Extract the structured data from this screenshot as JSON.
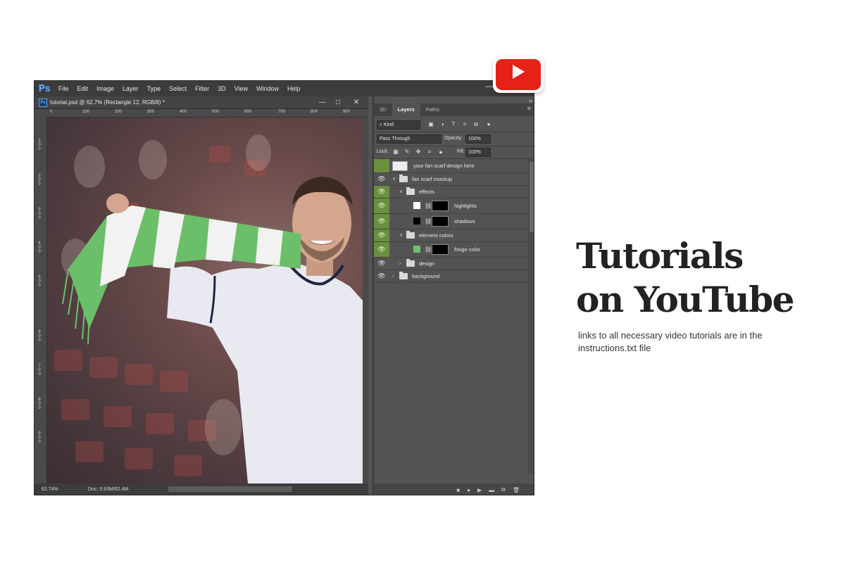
{
  "app": {
    "logo": "Ps",
    "menu": [
      "File",
      "Edit",
      "Image",
      "Layer",
      "Type",
      "Select",
      "Filter",
      "3D",
      "View",
      "Window",
      "Help"
    ],
    "minimize_glyph": "—"
  },
  "document": {
    "tab_icon": "Ps",
    "tab_title": "tutorial.psd @ 62.7% (Rectangle 12, RGB/8) *",
    "ctl_min": "—",
    "ctl_max": "□",
    "ctl_close": "✕",
    "ruler_top": [
      "0",
      "100",
      "200",
      "300",
      "400",
      "500",
      "600",
      "700",
      "800",
      "900"
    ],
    "ruler_left": [
      "100",
      "200",
      "300",
      "400",
      "500",
      "600",
      "700",
      "800",
      "900"
    ],
    "zoom": "62.74%",
    "doc_size": "Doc: 5.93M/62.4M"
  },
  "panel": {
    "collapse": "»",
    "menu_icon": "≡",
    "tabs": [
      "3D",
      "Layers",
      "Paths"
    ],
    "filter_kind": "⌕ Kind",
    "filter_icons": [
      "image-filter-icon",
      "adjustment-filter-icon",
      "type-filter-icon",
      "shape-filter-icon",
      "smart-object-filter-icon"
    ],
    "blend_mode": "Pass Through",
    "opacity_label": "Opacity:",
    "opacity_value": "100%",
    "lock_label": "Lock:",
    "fill_label": "Fill:",
    "fill_value": "100%",
    "layers": [
      {
        "name": "your fan scarf design here"
      },
      {
        "name": "fan scarf mockup"
      },
      {
        "name": "effects"
      },
      {
        "name": "highlights"
      },
      {
        "name": "shadows"
      },
      {
        "name": "element colors"
      },
      {
        "name": "fringe color"
      },
      {
        "name": "design"
      },
      {
        "name": "background"
      }
    ],
    "colors": {
      "eye_bg": "#6a8f3f",
      "fringe_swatch": "#6fbf73"
    }
  },
  "promo": {
    "headline_line1": "Tutorials",
    "headline_line2": "on YouTube",
    "description": "links to all necessary video tutorials are in the instructions.txt file",
    "youtube_color": "#e62117"
  }
}
